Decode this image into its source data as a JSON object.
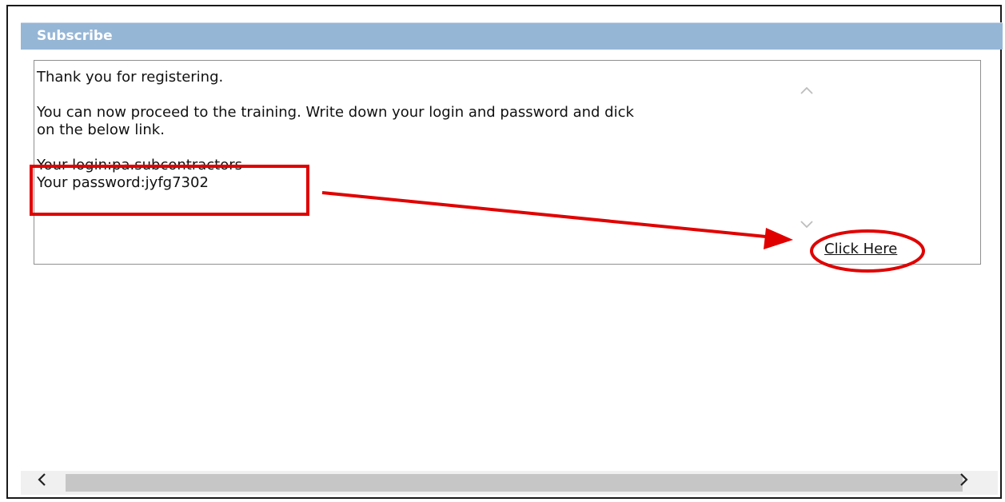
{
  "panel": {
    "title": "Subscribe"
  },
  "message": {
    "line1": "Thank you for registering.",
    "line2": "You can now proceed to the training. Write down your login and password and dick",
    "line3": "on the below link.",
    "login": "Your login:pa.subcontractors",
    "password": "Your password:jyfg7302"
  },
  "link": {
    "label": "Click Here"
  },
  "scrollbar": {
    "left_icon": "‹",
    "right_icon": "›",
    "up_icon": "^",
    "down_icon": "v"
  },
  "annotation": {
    "color": "#e00000"
  }
}
